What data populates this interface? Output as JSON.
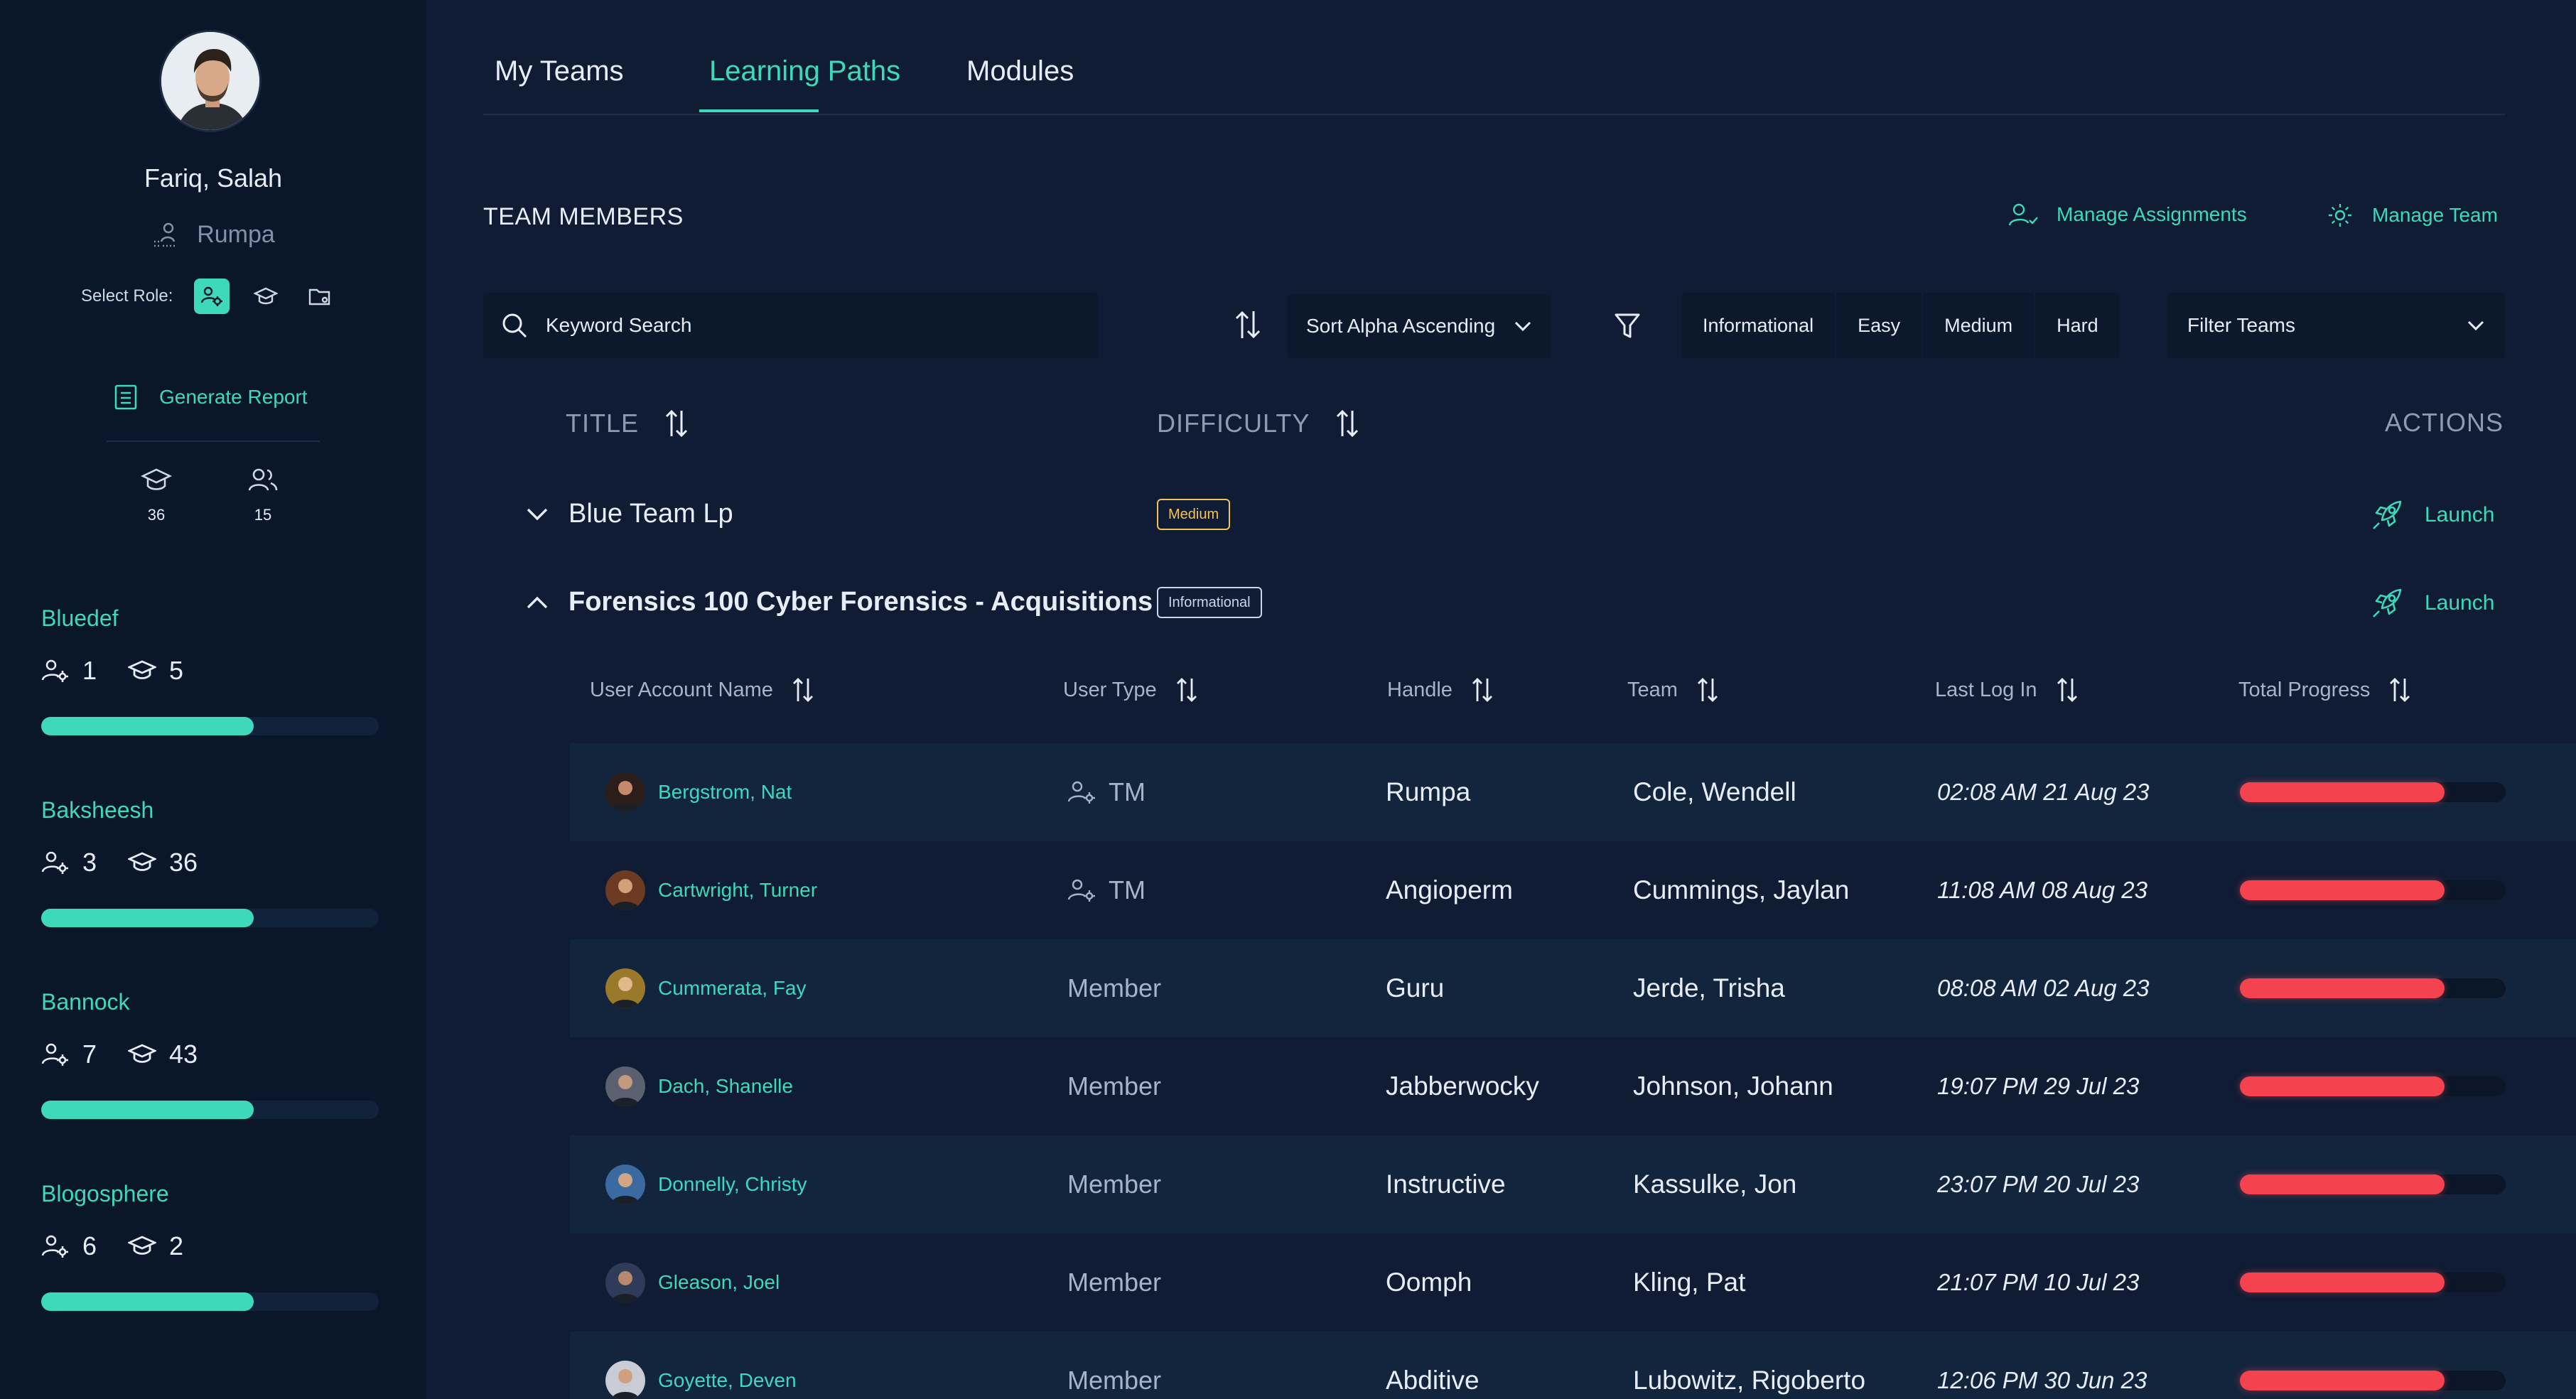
{
  "profile": {
    "name": "Fariq, Salah",
    "handle": "Rumpa",
    "select_role_label": "Select Role:",
    "generate_report": "Generate Report",
    "stats": [
      {
        "icon": "graduation-cap-icon",
        "value": "36"
      },
      {
        "icon": "users-icon",
        "value": "15"
      }
    ]
  },
  "teams": [
    {
      "name": "Bluedef",
      "members": "1",
      "paths": "5",
      "progress": 0.63
    },
    {
      "name": "Baksheesh",
      "members": "3",
      "paths": "36",
      "progress": 0.63
    },
    {
      "name": "Bannock",
      "members": "7",
      "paths": "43",
      "progress": 0.63
    },
    {
      "name": "Blogosphere",
      "members": "6",
      "paths": "2",
      "progress": 0.63
    }
  ],
  "tabs": [
    {
      "label": "My Teams",
      "active": false
    },
    {
      "label": "Learning Paths",
      "active": true
    },
    {
      "label": "Modules",
      "active": false
    }
  ],
  "header": {
    "title": "TEAM MEMBERS",
    "manage_assignments": "Manage Assignments",
    "manage_team": "Manage Team"
  },
  "toolbar": {
    "search_placeholder": "Keyword Search",
    "sort_value": "Sort Alpha Ascending",
    "difficulty_filters": [
      "Informational",
      "Easy",
      "Medium",
      "Hard"
    ],
    "team_filter": "Filter Teams"
  },
  "columns": {
    "title": "TITLE",
    "difficulty": "DIFFICULTY",
    "actions": "ACTIONS"
  },
  "learning_paths": [
    {
      "title": "Blue Team Lp",
      "difficulty": "Medium",
      "expanded": false,
      "action": "Launch"
    },
    {
      "title": "Forensics 100 Cyber Forensics - Acquisitions",
      "difficulty": "Informational",
      "expanded": true,
      "action": "Launch"
    }
  ],
  "member_columns": [
    "User Account Name",
    "User Type",
    "Handle",
    "Team",
    "Last Log In",
    "Total Progress"
  ],
  "members": [
    {
      "name": "Bergstrom,  Nat",
      "type": "TM",
      "handle": "Rumpa",
      "team": "Cole,  Wendell",
      "last_login": "02:08 AM 21 Aug 23",
      "progress": 0.77
    },
    {
      "name": "Cartwright,  Turner",
      "type": "TM",
      "handle": "Angioperm",
      "team": "Cummings,  Jaylan",
      "last_login": "11:08 AM 08 Aug 23",
      "progress": 0.77
    },
    {
      "name": "Cummerata,  Fay",
      "type": "Member",
      "handle": "Guru",
      "team": "Jerde,  Trisha",
      "last_login": "08:08 AM 02 Aug 23",
      "progress": 0.77
    },
    {
      "name": "Dach,  Shanelle",
      "type": "Member",
      "handle": "Jabberwocky",
      "team": "Johnson,  Johann",
      "last_login": "19:07 PM 29 Jul 23",
      "progress": 0.77
    },
    {
      "name": "Donnelly,  Christy",
      "type": "Member",
      "handle": "Instructive",
      "team": "Kassulke,  Jon",
      "last_login": "23:07 PM 20 Jul 23",
      "progress": 0.77
    },
    {
      "name": "Gleason,  Joel",
      "type": "Member",
      "handle": "Oomph",
      "team": "Kling,  Pat",
      "last_login": "21:07 PM 10 Jul 23",
      "progress": 0.77
    },
    {
      "name": "Goyette,  Deven",
      "type": "Member",
      "handle": "Abditive",
      "team": "Lubowitz,  Rigoberto",
      "last_login": "12:06 PM 30 Jun 23",
      "progress": 0.77
    }
  ],
  "colors": {
    "accent": "#3ed8bd",
    "progress": "#f5424f",
    "medium": "#f3c25a",
    "background": "#0f1c33",
    "sidebar": "#0a1629"
  }
}
